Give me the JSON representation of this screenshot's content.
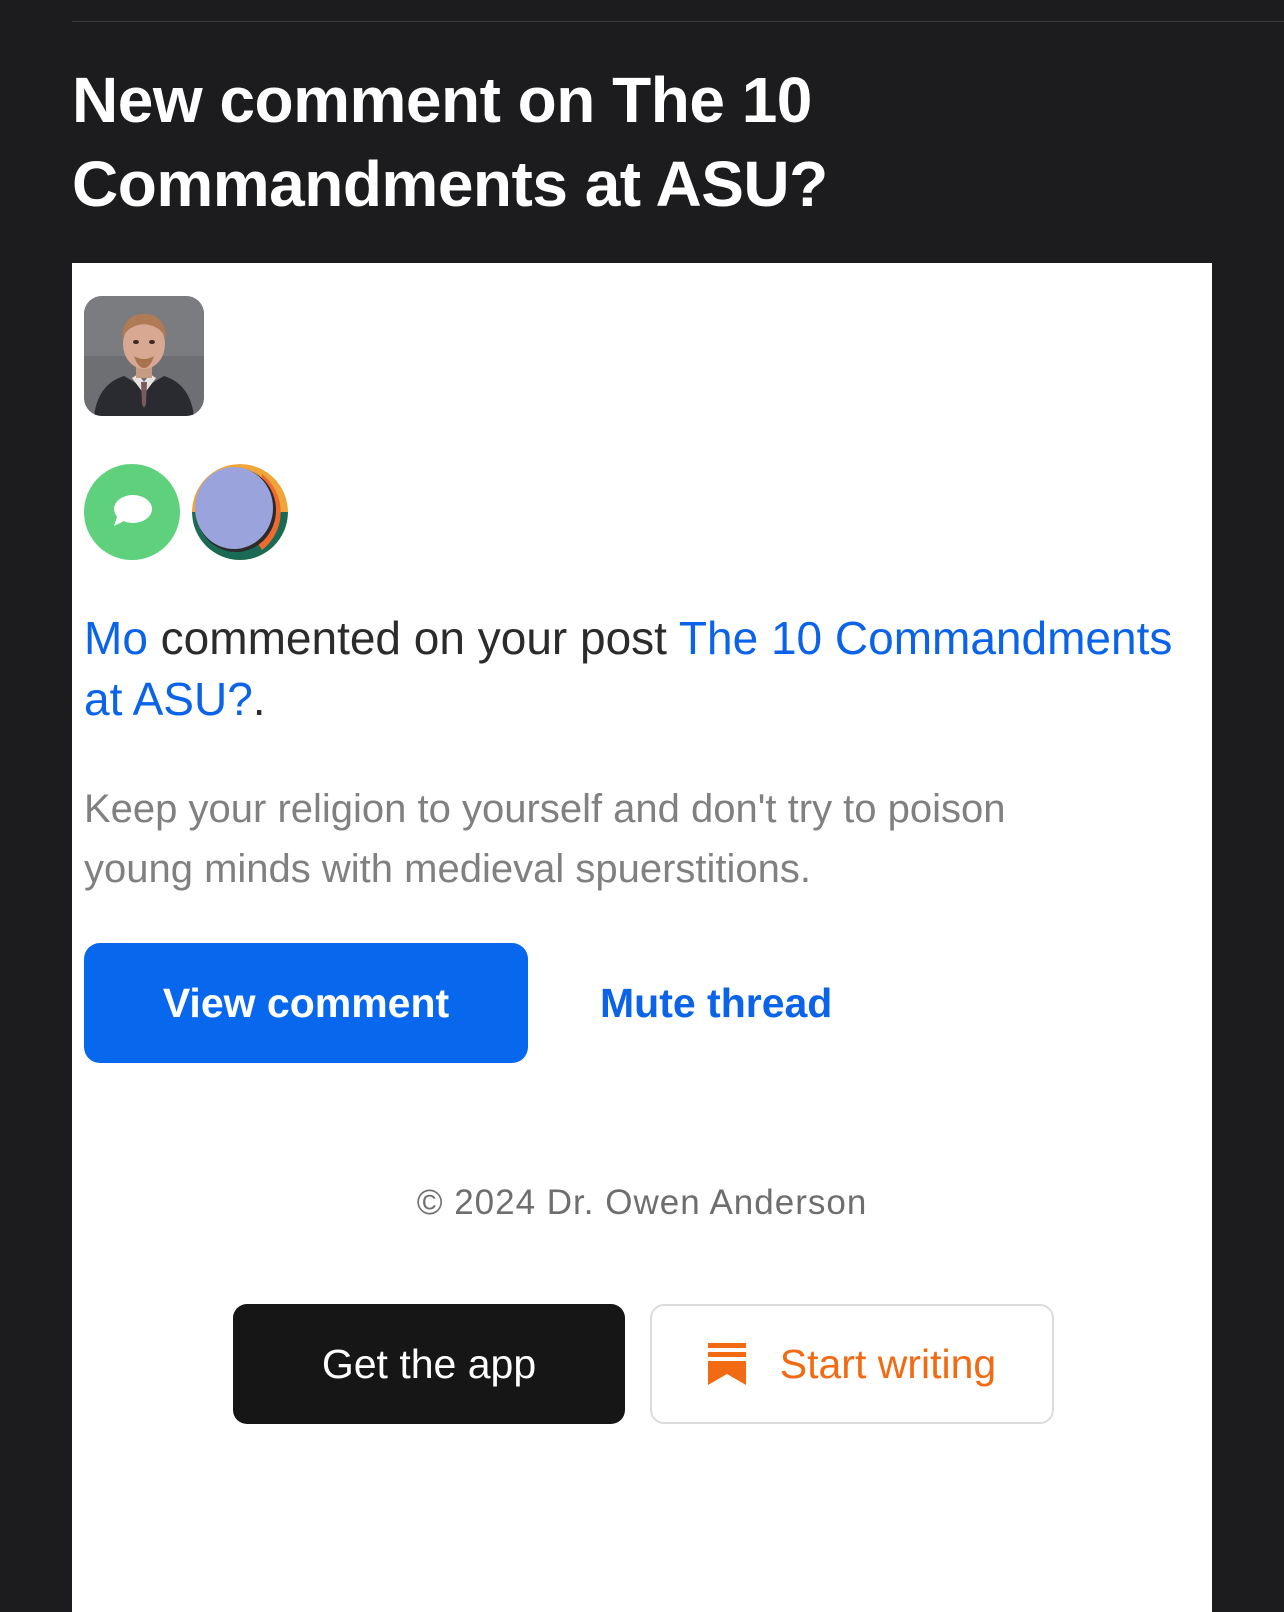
{
  "email": {
    "subject": "New comment on The 10 Commandments at ASU?"
  },
  "notification": {
    "author_photo": "author-avatar",
    "comment_badge_icon": "speech-bubble-icon",
    "publication_logo_icon": "publication-logo-icon",
    "commenter_name": "Mo",
    "action_text": " commented on your post ",
    "post_title": "The 10 Commandments at ASU?",
    "trailing_period": ".",
    "excerpt": "Keep your religion to yourself and don't try to poison young minds with medieval spuerstitions."
  },
  "actions": {
    "view_comment_label": "View comment",
    "mute_thread_label": "Mute thread"
  },
  "footer": {
    "copyright": "© 2024 Dr. Owen Anderson",
    "get_app_label": "Get the app",
    "start_writing_label": "Start writing",
    "start_writing_icon": "substack-bookmark-icon"
  },
  "colors": {
    "background": "#1c1c1e",
    "card": "#ffffff",
    "link": "#0a63e8",
    "primary_button": "#0768ee",
    "comment_badge": "#5fd17d",
    "start_writing_accent": "#f26a12",
    "dark_button": "#161616"
  }
}
